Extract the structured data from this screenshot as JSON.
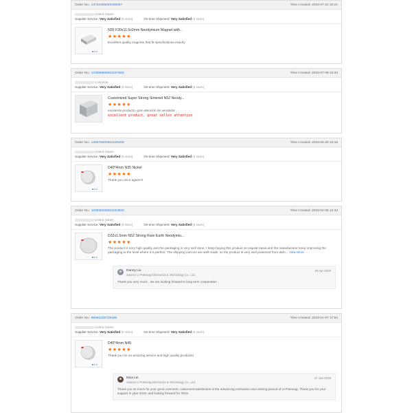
{
  "orders": [
    {
      "order_label": "Order No.:",
      "order_no": "1474330600102505?",
      "time_label": "Time Created:",
      "time_created": "2019-07-22 20:21",
      "country": "United States",
      "supplier_label": "Supplier Service:",
      "supplier_value": "Very Satisfied",
      "supplier_stars": "(5 stars)",
      "shipment_label": "On-time Shipment:",
      "shipment_value": "Very Satisfied",
      "shipment_stars": "(5 stars)",
      "product": "N35 F30x11.5x2mm Neodymium Magnet with...",
      "stars": "★★★★★",
      "review": "Excellent quality magnets that fit specifications exactly",
      "thumb": "block-magnet"
    },
    {
      "order_label": "Order No.:",
      "order_no": "123085865001027606",
      "time_label": "Time Created:",
      "time_created": "2019-07-09 10:33",
      "country": "Colombia",
      "supplier_label": "Supplier Service:",
      "supplier_value": "Very Satisfied",
      "supplier_stars": "(5 stars)",
      "shipment_label": "On-time Shipment:",
      "shipment_value": "Very Satisfied",
      "shipment_stars": "(5 stars)",
      "product": "Customized Super Strong Sintered N52 Neody...",
      "stars": "★★★★★",
      "review": "excelente producto, gran atención de vendedor",
      "review_extra": "excellent product, great seller attention",
      "thumb": "large-block"
    },
    {
      "order_label": "Order No.:",
      "order_no": "128675300001029108",
      "time_label": "Time Created:",
      "time_created": "2019-05-20 10:18",
      "country": "United States",
      "supplier_label": "Supplier Service:",
      "supplier_value": "Very Satisfied",
      "supplier_stars": "(5 stars)",
      "shipment_label": "On-time Shipment:",
      "shipment_value": "Very Satisfied",
      "shipment_stars": "(5 stars)",
      "product": "D40*4mm N35 Nickel",
      "stars": "★★★★★",
      "review": "Thank you once again!!!!",
      "thumb": "disc"
    },
    {
      "order_label": "Order No.:",
      "order_no": "103839435001023840",
      "time_label": "Time Created:",
      "time_created": "2019-04-05 12:43",
      "country": "United States",
      "supplier_label": "Supplier Service:",
      "supplier_value": "Very Satisfied",
      "supplier_stars": "(5 stars)",
      "shipment_label": "On-time Shipment:",
      "shipment_value": "Very Satisfied",
      "shipment_stars": "(5 stars)",
      "product": "D32x1.5mm N52 Strong Rare Earth Neodymiu...",
      "stars": "★★★★★",
      "review": "The product is very high quality and the packaging is very well done. I keep buying this product on regular basis and the manufacturer keep improving the packaging to the level where it is perfect. The shipping carrons are well made, so the product is very well protected from dam...",
      "view_more": "View More",
      "thumb": "thin-disc",
      "reply": {
        "name": "Danny Liu",
        "company": "Xiamen U Polemag Electronics & Technology Co., Ltd.",
        "date": "23 Apr 2019",
        "text": "Thank you very much , we are looking forward to long term cooperation"
      }
    },
    {
      "order_label": "Order No.:",
      "order_no": "95962228729188",
      "time_label": "Time Created:",
      "time_created": "2019-01-07 17:52",
      "country": "United States",
      "supplier_label": "Supplier Service:",
      "supplier_value": "Very Satisfied",
      "supplier_stars": "(5 stars)",
      "shipment_label": "On-time Shipment:",
      "shipment_value": "Very Satisfied",
      "shipment_stars": "(5 stars)",
      "product": "D45*4mm N45",
      "stars": "★★★★★",
      "review": "Thank you for an amazing service and high quality products!",
      "thumb": "disc",
      "reply": {
        "name": "Nina Lin",
        "company": "Xiamen U Polemag Electronics & Technology Co., Ltd.",
        "date": "07 Jan 2019",
        "text": "Thank you so much for your good comment, customers'satisfaction is the advancing motivation and untiring pursuit of U-Polemag. Thank you for your support in year 2018, and looking forward for 2019."
      }
    }
  ]
}
